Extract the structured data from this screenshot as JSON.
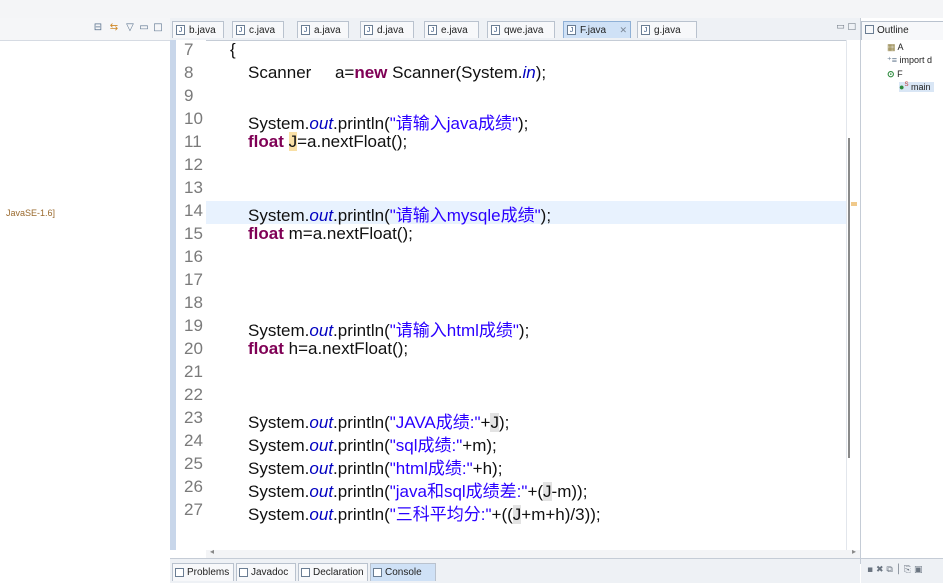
{
  "left_panel": {
    "jre_label": "JavaSE-1.6]"
  },
  "editor": {
    "tabs": [
      {
        "label": "b.java",
        "active": false
      },
      {
        "label": "c.java",
        "active": false
      },
      {
        "label": "a.java",
        "active": false
      },
      {
        "label": "d.java",
        "active": false
      },
      {
        "label": "e.java",
        "active": false
      },
      {
        "label": "qwe.java",
        "active": false
      },
      {
        "label": "F.java",
        "active": true
      },
      {
        "label": "g.java",
        "active": false
      }
    ],
    "line_numbers": [
      "7",
      "8",
      "9",
      "10",
      "11",
      "12",
      "13",
      "14",
      "15",
      "16",
      "17",
      "18",
      "19",
      "20",
      "21",
      "22",
      "23",
      "24",
      "25",
      "26",
      "27"
    ],
    "code": {
      "l7": "{",
      "l8_type": "Scanner",
      "l8_var": "a=",
      "l8_new": "new",
      "l8_ctor": " Scanner(System.",
      "l8_in": "in",
      "l8_end": ");",
      "sys": "System.",
      "out": "out",
      "println": ".println(",
      "l10_str": "\"请输入java成绩\"",
      "l14_str": "\"请输入mysqle成绩\"",
      "l18_str": "\"请输入html成绩\"",
      "end_paren": ");",
      "float_kw": "float",
      "l11_var": "J",
      "l11_rest": "=a.nextFloat();",
      "l15_rest": " m=a.nextFloat();",
      "l19_rest": " h=a.nextFloat();",
      "l22_str": "\"JAVA成绩:\"",
      "l22_plus": "+",
      "l22_j": "J",
      "l23_str": "\"sql成绩:\"",
      "l23_rest": "+m);",
      "l24_str": "\"html成绩:\"",
      "l24_rest": "+h);",
      "l25_str": "\"java和sql成绩差:\"",
      "l25_a": "+(",
      "l25_j": "J",
      "l25_b": "-m));",
      "l26_str": "\"三科平均分:\"",
      "l26_a": "+((",
      "l26_j": "J",
      "l26_b": "+m+h)/3));"
    }
  },
  "bottom_tabs": [
    "Problems",
    "Javadoc",
    "Declaration",
    "Console"
  ],
  "outline": {
    "tab_label": "Outline",
    "items": [
      "A",
      "import d",
      "F",
      "main"
    ]
  },
  "colors": {
    "keyword": "#7f0055",
    "string": "#2a00ff",
    "static_field": "#0000c0",
    "current_line": "#e8f2fe"
  }
}
